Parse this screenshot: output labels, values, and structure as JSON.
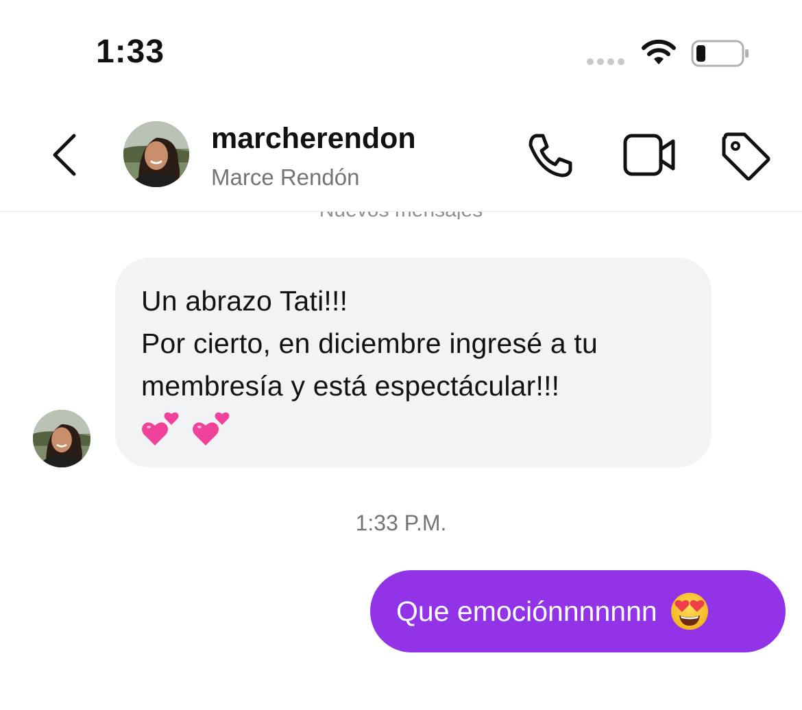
{
  "status_bar": {
    "time": "1:33",
    "icons": [
      "signal-dots-icon",
      "wifi-icon",
      "battery-icon"
    ]
  },
  "header": {
    "username": "marcherendon",
    "full_name": "Marce Rendón",
    "icons": [
      "back-chevron-icon",
      "phone-icon",
      "video-camera-icon",
      "tag-icon"
    ]
  },
  "conversation": {
    "divider_label": "Nuevos mensajes",
    "incoming": {
      "line1": "Un abrazo Tati!!!",
      "line2": "Por cierto, en diciembre ingresé a tu",
      "line3": "membresía y está espectácular!!!",
      "emoji": [
        "two-hearts-emoji",
        "two-hearts-emoji"
      ]
    },
    "timestamp": "1:33 P.M.",
    "outgoing": {
      "text": "Que emociónnnnnnn",
      "emoji": "heart-eyes-emoji"
    }
  },
  "colors": {
    "outgoing_bubble": "#9333e8",
    "incoming_bubble": "#f2f3f5",
    "secondary_text": "#737378",
    "heart_pink": "#f0419b"
  }
}
